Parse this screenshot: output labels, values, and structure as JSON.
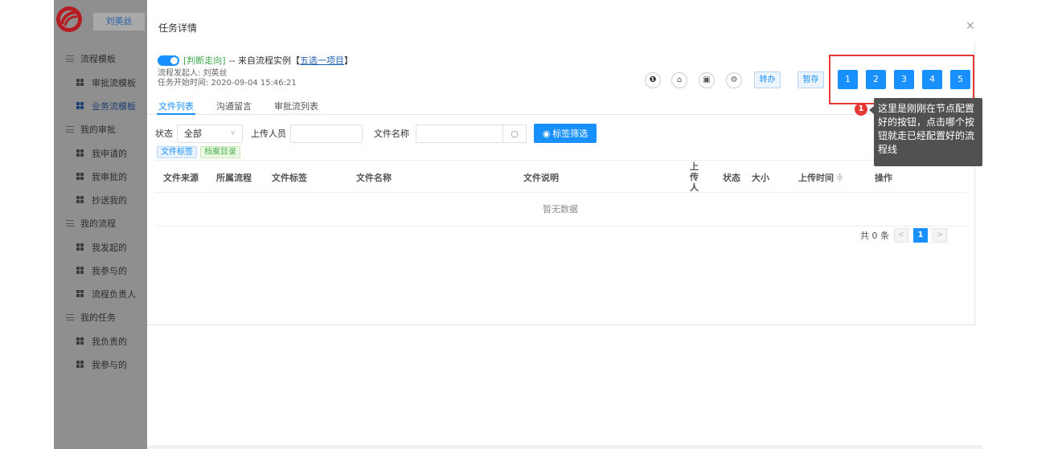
{
  "sidebar": {
    "user": "刘英丝",
    "menu": [
      {
        "type": "group",
        "label": "流程模板"
      },
      {
        "type": "item",
        "label": "审批流模板"
      },
      {
        "type": "item",
        "label": "业务流模板",
        "active": true
      },
      {
        "type": "group",
        "label": "我的审批"
      },
      {
        "type": "item",
        "label": "我申请的"
      },
      {
        "type": "item",
        "label": "我审批的"
      },
      {
        "type": "item",
        "label": "抄送我的"
      },
      {
        "type": "group",
        "label": "我的流程"
      },
      {
        "type": "item",
        "label": "我发起的"
      },
      {
        "type": "item",
        "label": "我参与的"
      },
      {
        "type": "item",
        "label": "流程负责人"
      },
      {
        "type": "group",
        "label": "我的任务"
      },
      {
        "type": "item",
        "label": "我负责的"
      },
      {
        "type": "item",
        "label": "我参与的"
      }
    ]
  },
  "dialog": {
    "title": "任务详情",
    "close": "×"
  },
  "header": {
    "tag": "[判断走向]",
    "from_text": "-- 来自流程实例【",
    "instance": "五选一项目",
    "from_end": "】",
    "initiator": "流程发起人: 刘英丝",
    "start_time": "任务开始时间: 2020-09-04 15:46:21"
  },
  "actions": {
    "transfer": "转办",
    "save": "暂存",
    "nodes": [
      "1",
      "2",
      "3",
      "4",
      "5"
    ]
  },
  "tabs": [
    "文件列表",
    "沟通留言",
    "审批流列表"
  ],
  "filters": {
    "status_label": "状态",
    "status_value": "全部",
    "uploader_label": "上传人员",
    "filename_label": "文件名称",
    "tag_filter": "标签筛选"
  },
  "chips": [
    "文件标签",
    "档案目录"
  ],
  "table": {
    "columns": [
      "文件来源",
      "所属流程",
      "文件标签",
      "文件名称",
      "文件说明",
      "上传人",
      "状态",
      "大小",
      "上传时间",
      "操作"
    ],
    "sort_icon": "≑",
    "empty": "暂无数据"
  },
  "pager": {
    "total": "共 0 条",
    "page": "1",
    "prev": "<",
    "next": ">"
  },
  "tooltip": {
    "badge": "1",
    "text": "这里是刚刚在节点配置好的按钮，点击哪个按钮就走已经配置好的流程线"
  },
  "colors": {
    "primary": "#1890ff",
    "highlight_frame": "#e53935",
    "tooltip_bg": "#515151"
  }
}
